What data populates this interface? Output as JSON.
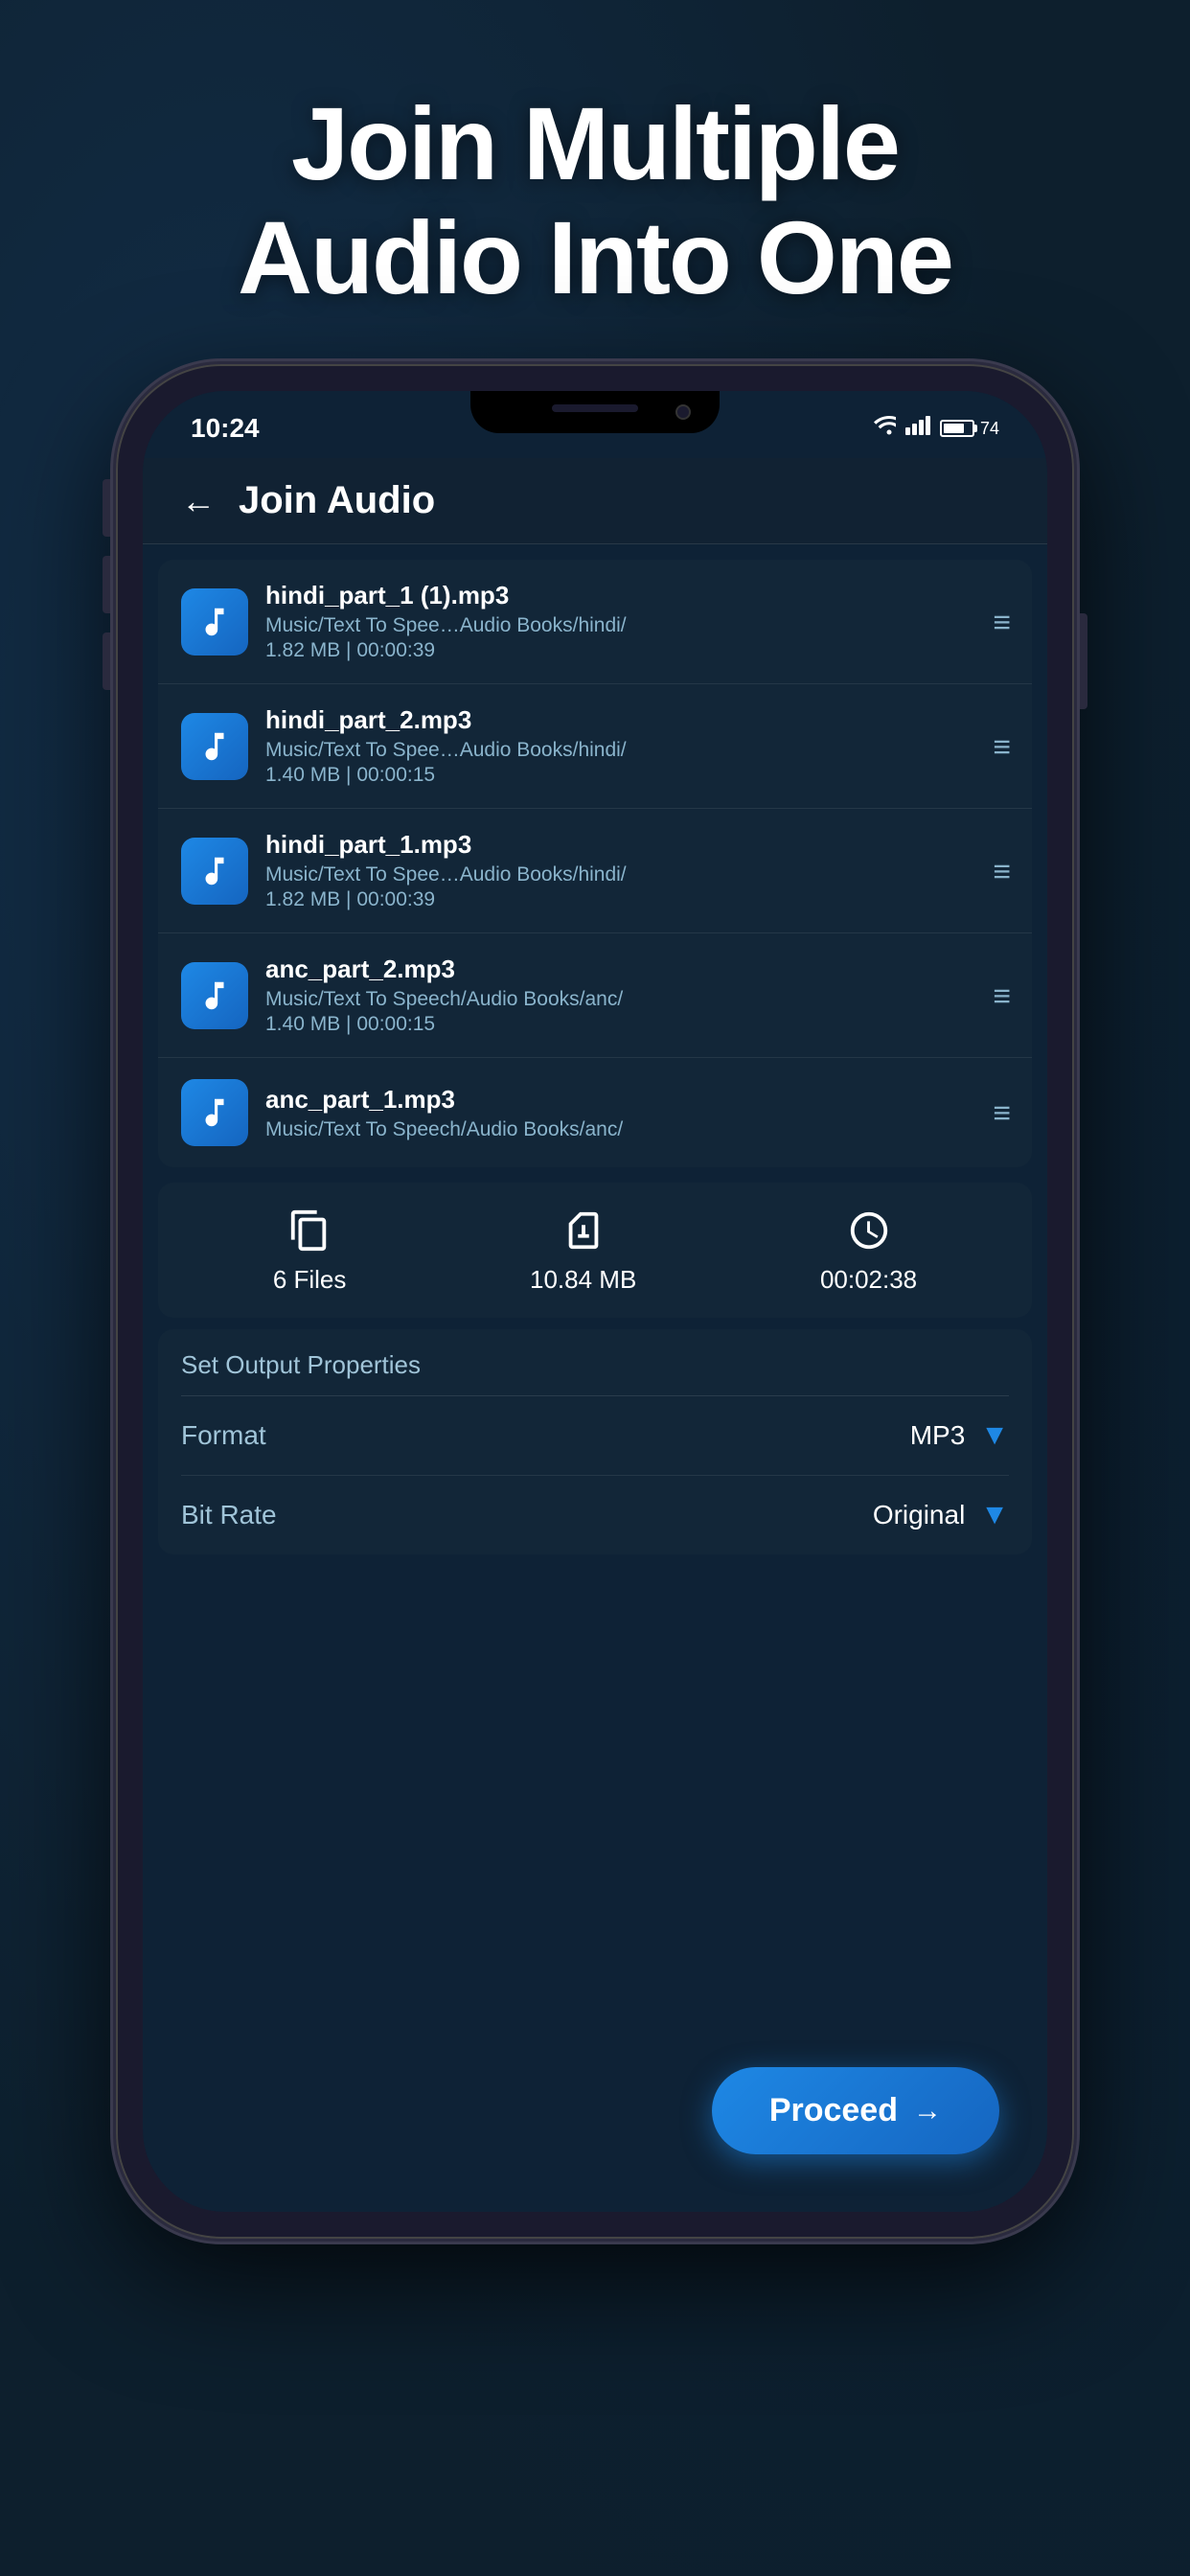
{
  "hero": {
    "title": "Join Multiple\nAudio Into One"
  },
  "status_bar": {
    "time": "10:24",
    "battery_percent": "74"
  },
  "app_header": {
    "title": "Join Audio",
    "back_label": "←"
  },
  "files": [
    {
      "name": "hindi_part_1 (1).mp3",
      "path": "Music/Text To Spee…Audio Books/hindi/",
      "meta": "1.82 MB | 00:00:39"
    },
    {
      "name": "hindi_part_2.mp3",
      "path": "Music/Text To Spee…Audio Books/hindi/",
      "meta": "1.40 MB | 00:00:15"
    },
    {
      "name": "hindi_part_1.mp3",
      "path": "Music/Text To Spee…Audio Books/hindi/",
      "meta": "1.82 MB | 00:00:39"
    },
    {
      "name": "anc_part_2.mp3",
      "path": "Music/Text To Speech/Audio Books/anc/",
      "meta": "1.40 MB | 00:00:15"
    },
    {
      "name": "anc_part_1.mp3",
      "path": "Music/Text To Speech/Audio Books/anc/",
      "meta": ""
    }
  ],
  "stats": {
    "files_count": "6 Files",
    "total_size": "10.84 MB",
    "total_duration": "00:02:38"
  },
  "output_properties": {
    "section_title": "Set Output Properties",
    "format_label": "Format",
    "format_value": "MP3",
    "bitrate_label": "Bit Rate",
    "bitrate_value": "Original"
  },
  "proceed_button": {
    "label": "Proceed"
  }
}
